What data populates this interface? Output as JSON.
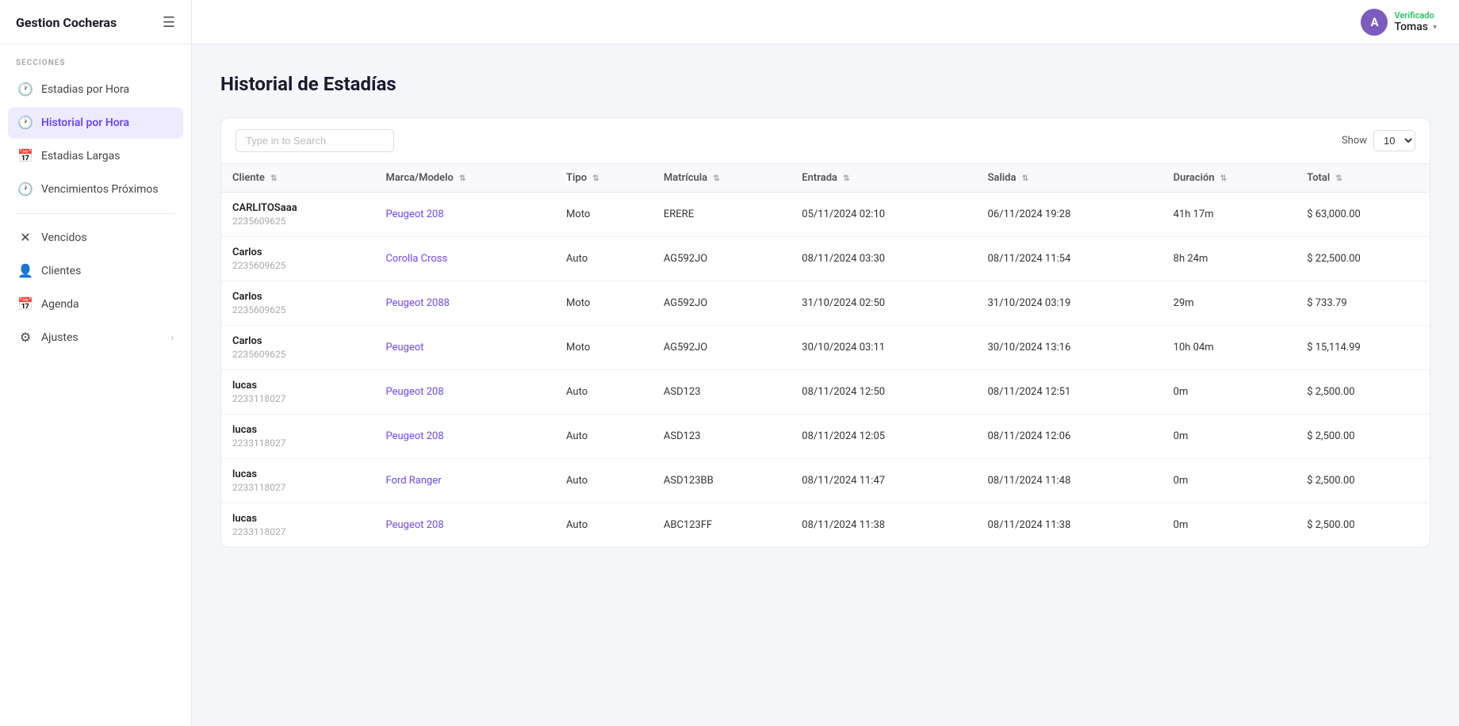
{
  "app": {
    "title": "Gestion Cocheras",
    "hamburger": "☰"
  },
  "topbar": {
    "verified_label": "Verificado",
    "user_name": "Tomas",
    "user_initial": "A",
    "dropdown_arrow": "▾"
  },
  "sidebar": {
    "section_label": "SECCIONES",
    "items": [
      {
        "id": "estadias-hora",
        "label": "Estadias por Hora",
        "icon": "🕐",
        "active": false
      },
      {
        "id": "historial-hora",
        "label": "Historial por Hora",
        "icon": "🕐",
        "active": true
      },
      {
        "id": "estadias-largas",
        "label": "Estadias Largas",
        "icon": "📅",
        "active": false
      },
      {
        "id": "vencimientos-proximos",
        "label": "Vencimientos Próximos",
        "icon": "🕐",
        "active": false
      },
      {
        "id": "vencidos",
        "label": "Vencidos",
        "icon": "✕",
        "active": false
      },
      {
        "id": "clientes",
        "label": "Clientes",
        "icon": "👤",
        "active": false
      },
      {
        "id": "agenda",
        "label": "Agenda",
        "icon": "📅",
        "active": false
      },
      {
        "id": "ajustes",
        "label": "Ajustes",
        "icon": "⚙",
        "active": false,
        "has_chevron": true
      }
    ]
  },
  "page": {
    "title": "Historial de Estadías"
  },
  "toolbar": {
    "search_placeholder": "Type in to Search",
    "show_label": "Show",
    "show_value": "10"
  },
  "table": {
    "columns": [
      {
        "id": "cliente",
        "label": "Cliente",
        "sortable": true
      },
      {
        "id": "marca_modelo",
        "label": "Marca/Modelo",
        "sortable": true
      },
      {
        "id": "tipo",
        "label": "Tipo",
        "sortable": true
      },
      {
        "id": "matricula",
        "label": "Matrícula",
        "sortable": true
      },
      {
        "id": "entrada",
        "label": "Entrada",
        "sortable": true
      },
      {
        "id": "salida",
        "label": "Salida",
        "sortable": true
      },
      {
        "id": "duracion",
        "label": "Duración",
        "sortable": true
      },
      {
        "id": "total",
        "label": "Total",
        "sortable": true
      }
    ],
    "rows": [
      {
        "client_name": "CARLITOSaaa",
        "client_phone": "2235609625",
        "brand_model": "Peugeot 208",
        "tipo": "Moto",
        "matricula": "ERERE",
        "entrada": "05/11/2024 02:10",
        "salida": "06/11/2024 19:28",
        "duracion": "41h 17m",
        "total": "$ 63,000.00"
      },
      {
        "client_name": "Carlos",
        "client_phone": "2235609625",
        "brand_model": "Corolla Cross",
        "tipo": "Auto",
        "matricula": "AG592JO",
        "entrada": "08/11/2024 03:30",
        "salida": "08/11/2024 11:54",
        "duracion": "8h 24m",
        "total": "$ 22,500.00"
      },
      {
        "client_name": "Carlos",
        "client_phone": "2235609625",
        "brand_model": "Peugeot 2088",
        "tipo": "Moto",
        "matricula": "AG592JO",
        "entrada": "31/10/2024 02:50",
        "salida": "31/10/2024 03:19",
        "duracion": "29m",
        "total": "$ 733.79"
      },
      {
        "client_name": "Carlos",
        "client_phone": "2235609625",
        "brand_model": "Peugeot",
        "tipo": "Moto",
        "matricula": "AG592JO",
        "entrada": "30/10/2024 03:11",
        "salida": "30/10/2024 13:16",
        "duracion": "10h 04m",
        "total": "$ 15,114.99"
      },
      {
        "client_name": "lucas",
        "client_phone": "2233118027",
        "brand_model": "Peugeot 208",
        "tipo": "Auto",
        "matricula": "ASD123",
        "entrada": "08/11/2024 12:50",
        "salida": "08/11/2024 12:51",
        "duracion": "0m",
        "total": "$ 2,500.00"
      },
      {
        "client_name": "lucas",
        "client_phone": "2233118027",
        "brand_model": "Peugeot 208",
        "tipo": "Auto",
        "matricula": "ASD123",
        "entrada": "08/11/2024 12:05",
        "salida": "08/11/2024 12:06",
        "duracion": "0m",
        "total": "$ 2,500.00"
      },
      {
        "client_name": "lucas",
        "client_phone": "2233118027",
        "brand_model": "Ford Ranger",
        "tipo": "Auto",
        "matricula": "ASD123BB",
        "entrada": "08/11/2024 11:47",
        "salida": "08/11/2024 11:48",
        "duracion": "0m",
        "total": "$ 2,500.00"
      },
      {
        "client_name": "lucas",
        "client_phone": "2233118027",
        "brand_model": "Peugeot 208",
        "tipo": "Auto",
        "matricula": "ABC123FF",
        "entrada": "08/11/2024 11:38",
        "salida": "08/11/2024 11:38",
        "duracion": "0m",
        "total": "$ 2,500.00"
      }
    ]
  }
}
